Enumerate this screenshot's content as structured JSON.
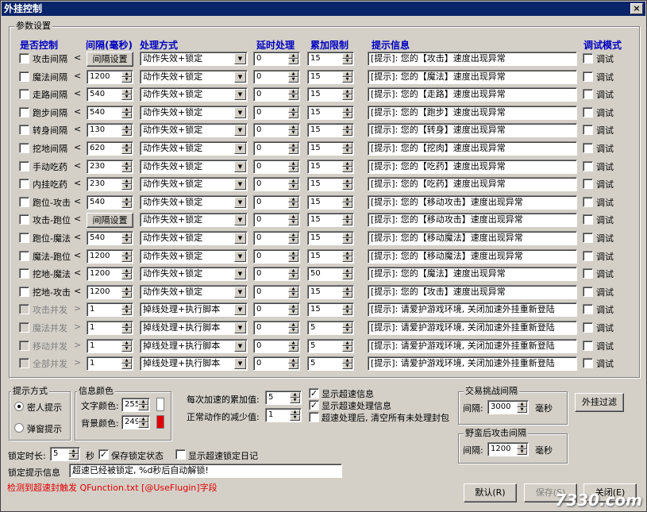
{
  "window": {
    "title": "外挂控制",
    "close": "×"
  },
  "params_group": {
    "label": "参数设置"
  },
  "headers": {
    "enable": "是否控制",
    "interval": "间隔(毫秒)",
    "method": "处理方式",
    "delay": "延时处理",
    "limit": "累加限制",
    "message": "提示信息",
    "debug": "调试模式"
  },
  "rows": [
    {
      "label": "攻击间隔",
      "arrow": "<",
      "interval": "间隔设置",
      "interval_is_button": true,
      "method": "动作失效+锁定",
      "delay": "0",
      "limit": "15",
      "message": "[提示]: 您的【攻击】速度出现异常",
      "debug": "调试",
      "enabled": true
    },
    {
      "label": "魔法间隔",
      "arrow": "<",
      "interval": "1200",
      "method": "动作失效+锁定",
      "delay": "0",
      "limit": "15",
      "message": "[提示]: 您的【魔法】速度出现异常",
      "debug": "调试",
      "enabled": true
    },
    {
      "label": "走路间隔",
      "arrow": "<",
      "interval": "540",
      "method": "动作失效+锁定",
      "delay": "0",
      "limit": "15",
      "message": "[提示]: 您的【走路】速度出现异常",
      "debug": "调试",
      "enabled": true
    },
    {
      "label": "跑步间隔",
      "arrow": "<",
      "interval": "540",
      "method": "动作失效+锁定",
      "delay": "0",
      "limit": "15",
      "message": "[提示]: 您的【跑步】速度出现异常",
      "debug": "调试",
      "enabled": true
    },
    {
      "label": "转身间隔",
      "arrow": "<",
      "interval": "130",
      "method": "动作失效+锁定",
      "delay": "0",
      "limit": "15",
      "message": "[提示]: 您的【转身】速度出现异常",
      "debug": "调试",
      "enabled": true
    },
    {
      "label": "挖地间隔",
      "arrow": "<",
      "interval": "620",
      "method": "动作失效+锁定",
      "delay": "0",
      "limit": "15",
      "message": "[提示]: 您的【挖肉】速度出现异常",
      "debug": "调试",
      "enabled": true
    },
    {
      "label": "手动吃药",
      "arrow": "<",
      "interval": "230",
      "method": "动作失效+锁定",
      "delay": "0",
      "limit": "15",
      "message": "[提示]: 您的【吃药】速度出现异常",
      "debug": "调试",
      "enabled": true
    },
    {
      "label": "内挂吃药",
      "arrow": "<",
      "interval": "230",
      "method": "动作失效+锁定",
      "delay": "0",
      "limit": "15",
      "message": "[提示]: 您的【吃药】速度出现异常",
      "debug": "调试",
      "enabled": true
    },
    {
      "label": "跑位-攻击",
      "arrow": "<",
      "interval": "540",
      "method": "动作失效+锁定",
      "delay": "0",
      "limit": "15",
      "message": "[提示]: 您的【移动攻击】速度出现异常",
      "debug": "调试",
      "enabled": true
    },
    {
      "label": "攻击-跑位",
      "arrow": "<",
      "interval": "间隔设置",
      "interval_is_button": true,
      "method": "动作失效+锁定",
      "delay": "0",
      "limit": "15",
      "message": "[提示]: 您的【移动攻击】速度出现异常",
      "debug": "调试",
      "enabled": true
    },
    {
      "label": "跑位-魔法",
      "arrow": "<",
      "interval": "540",
      "method": "动作失效+锁定",
      "delay": "0",
      "limit": "15",
      "message": "[提示]: 您的【移动魔法】速度出现异常",
      "debug": "调试",
      "enabled": true
    },
    {
      "label": "魔法-跑位",
      "arrow": "<",
      "interval": "1200",
      "method": "动作失效+锁定",
      "delay": "0",
      "limit": "15",
      "message": "[提示]: 您的【移动魔法】速度出现异常",
      "debug": "调试",
      "enabled": true
    },
    {
      "label": "挖地-魔法",
      "arrow": "<",
      "interval": "1200",
      "method": "动作失效+锁定",
      "delay": "0",
      "limit": "50",
      "message": "[提示]: 您的【魔法】速度出现异常",
      "debug": "调试",
      "enabled": true
    },
    {
      "label": "挖地-攻击",
      "arrow": "<",
      "interval": "1200",
      "method": "动作失效+锁定",
      "delay": "0",
      "limit": "15",
      "message": "[提示]: 您的【攻击】速度出现异常",
      "debug": "调试",
      "enabled": true
    },
    {
      "label": "攻击并发",
      "arrow": ">",
      "interval": "1",
      "method": "掉线处理+执行脚本",
      "delay": "0",
      "limit": "15",
      "message": "[提示]: 请爱护游戏环境, 关闭加速外挂重新登陆",
      "debug": "调试",
      "enabled": false
    },
    {
      "label": "魔法并发",
      "arrow": ">",
      "interval": "1",
      "method": "掉线处理+执行脚本",
      "delay": "0",
      "limit": "5",
      "message": "[提示]: 请爱护游戏环境, 关闭加速外挂重新登陆",
      "debug": "调试",
      "enabled": false
    },
    {
      "label": "移动并发",
      "arrow": ">",
      "interval": "1",
      "method": "掉线处理+执行脚本",
      "delay": "0",
      "limit": "5",
      "message": "[提示]: 请爱护游戏环境, 关闭加速外挂重新登陆",
      "debug": "调试",
      "enabled": false
    },
    {
      "label": "全部并发",
      "arrow": ">",
      "interval": "1",
      "method": "掉线处理+执行脚本",
      "delay": "0",
      "limit": "5",
      "message": "[提示]: 请爱护游戏环境, 关闭加速外挂重新登陆",
      "debug": "调试",
      "enabled": false
    }
  ],
  "hint_mode": {
    "label": "提示方式",
    "secret": "密人提示",
    "popup": "弹窗提示"
  },
  "info_color": {
    "label": "信息颜色",
    "text_color_label": "文字颜色:",
    "text_color_value": "255",
    "bg_color_label": "背景颜色:",
    "bg_color_value": "249",
    "text_swatch": "#ffffff",
    "bg_swatch": "#e00000"
  },
  "accel": {
    "add_label": "每次加速的累加值:",
    "add_value": "5",
    "dec_label": "正常动作的减少值:",
    "dec_value": "1"
  },
  "options": {
    "show_speed_info": "显示超速信息",
    "show_speed_handle": "显示超速处理信息",
    "clear_packets": "超速处理后, 清空所有未处理封包"
  },
  "trade": {
    "label": "交易挑战间隔",
    "interval_label": "间隔:",
    "value": "3000",
    "unit": "毫秒"
  },
  "yeman": {
    "label": "野蛮后攻击间隔",
    "interval_label": "间隔:",
    "value": "1200",
    "unit": "毫秒"
  },
  "buttons": {
    "filter": "外挂过滤",
    "default": "默认(R)",
    "save": "保存(S)",
    "close": "关闭(E)"
  },
  "lock": {
    "duration_label": "锁定时长:",
    "duration_value": "5",
    "seconds": "秒",
    "save_state": "保存锁定状态",
    "show_log": "显示超速锁定日记"
  },
  "lock_message": {
    "label": "锁定提示信息",
    "value": "超速已经被锁定, %d秒后自动解锁!"
  },
  "status": {
    "text": "检测到超速封触发 QFunction.txt [@UseFlugin]字段"
  },
  "watermark": "7330.com"
}
